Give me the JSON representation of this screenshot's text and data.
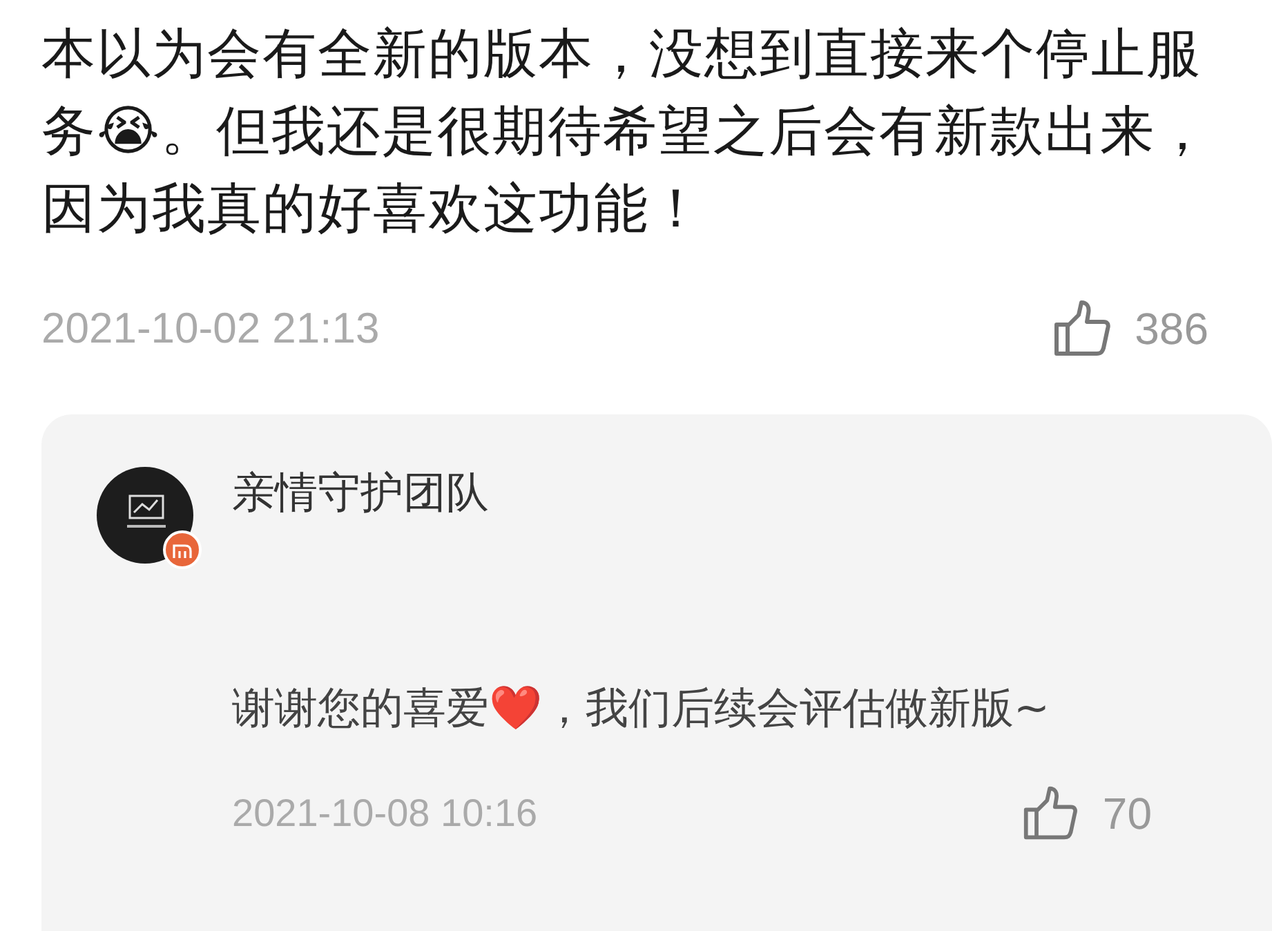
{
  "comment": {
    "text": "本以为会有全新的版本，没想到直接来个停止服务😭。但我还是很期待希望之后会有新款出来，因为我真的好喜欢这功能！",
    "time": "2021-10-02 21:13",
    "likes": "386"
  },
  "reply": {
    "author": "亲情守护团队",
    "text": "谢谢您的喜爱❤️，我们后续会评估做新版~",
    "time": "2021-10-08 10:16",
    "likes": "70"
  }
}
